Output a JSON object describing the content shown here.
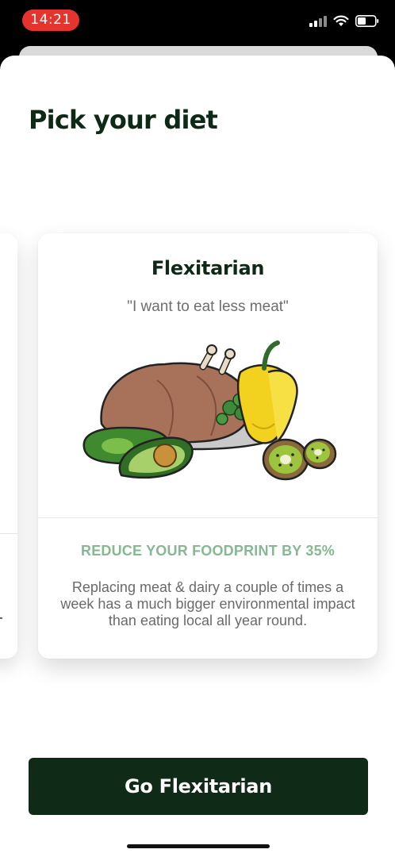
{
  "status_bar": {
    "time": "14:21",
    "time_pill_color": "#e5332d",
    "icons": [
      "cellular-signal-icon",
      "wifi-icon",
      "battery-icon"
    ]
  },
  "page": {
    "title": "Pick your diet"
  },
  "card": {
    "title": "Flexitarian",
    "quote": "\"I want to eat less meat\"",
    "illustration": "food-illustration",
    "highlight": "REDUCE YOUR FOODPRINT BY 35%",
    "description": "Replacing meat & dairy a couple of times a week has a much bigger environmental impact than eating local all year round."
  },
  "cta": {
    "label": "Go Flexitarian"
  },
  "colors": {
    "title_green": "#0e2a16",
    "button_bg": "#0f2a16",
    "highlight_green": "#86b894",
    "body_gray": "#6a6a6a"
  }
}
